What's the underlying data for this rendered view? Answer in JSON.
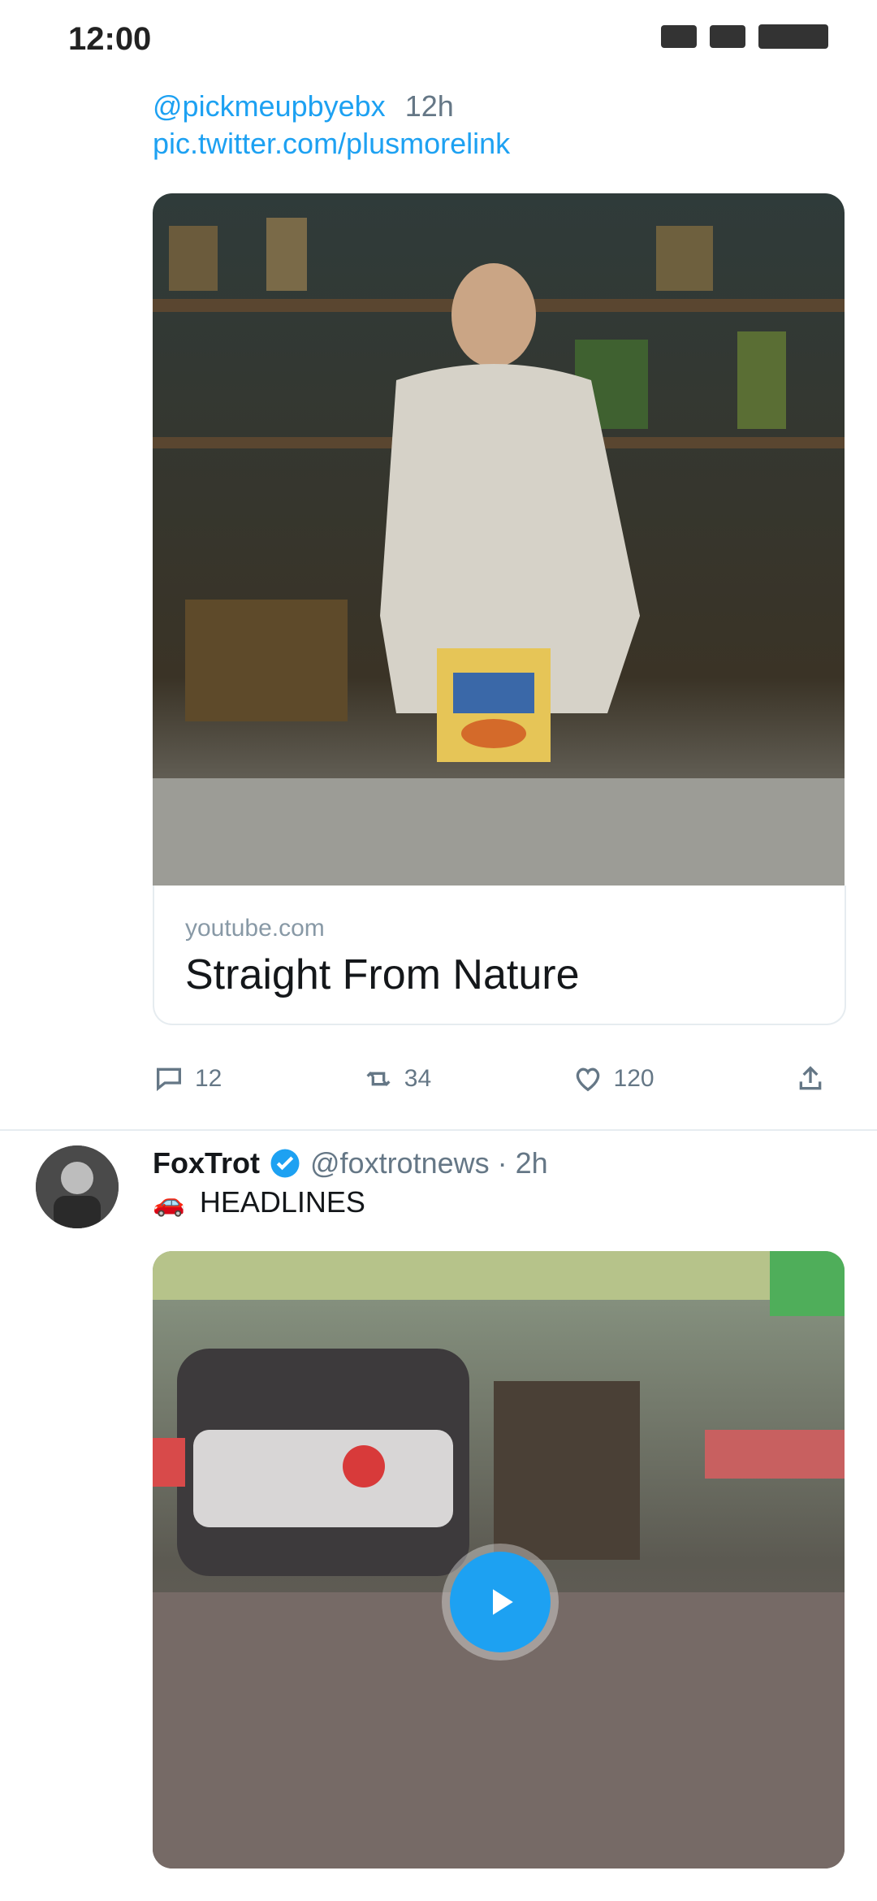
{
  "status_bar": {
    "time": "12:00"
  },
  "tweet1": {
    "handle": "@pickmeupbyebx",
    "time": "12h",
    "link_line": "pic.twitter.com/plusmorelink",
    "card": {
      "domain": "youtube.com",
      "title": "Straight From Nature"
    },
    "actions": {
      "reply_count": "12",
      "retweet_count": "34",
      "like_count": "120"
    }
  },
  "tweet2": {
    "name": "FoxTrot",
    "handle": "@foxtrotnews",
    "dot": "·",
    "time": "2h",
    "emoji": "🚗",
    "text": "HEADLINES"
  },
  "colors": {
    "accent": "#1da1f2",
    "muted": "#657786",
    "divider": "#e6ecf0"
  },
  "icons": [
    "signal-icon",
    "wifi-icon",
    "battery-icon",
    "reply-icon",
    "retweet-icon",
    "like-icon",
    "share-icon",
    "verified-icon",
    "play-icon"
  ]
}
